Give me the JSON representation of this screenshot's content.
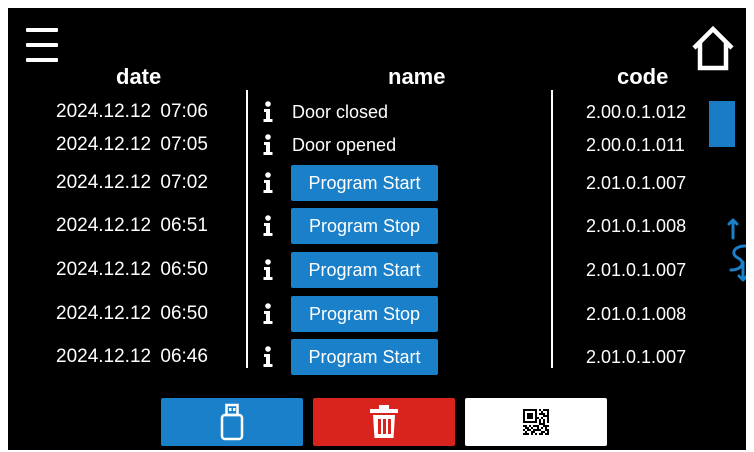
{
  "header": {
    "date": "date",
    "name": "name",
    "code": "code"
  },
  "rows": [
    {
      "date": "2024.12.12 07:06",
      "name": "Door closed",
      "code": "2.00.0.1.012",
      "button": false
    },
    {
      "date": "2024.12.12 07:05",
      "name": "Door opened",
      "code": "2.00.0.1.011",
      "button": false
    },
    {
      "date": "2024.12.12 07:02",
      "name": "Program Start",
      "code": "2.01.0.1.007",
      "button": true
    },
    {
      "date": "2024.12.12 06:51",
      "name": "Program Stop",
      "code": "2.01.0.1.008",
      "button": true
    },
    {
      "date": "2024.12.12 06:50",
      "name": "Program Start",
      "code": "2.01.0.1.007",
      "button": true
    },
    {
      "date": "2024.12.12 06:50",
      "name": "Program Stop",
      "code": "2.01.0.1.008",
      "button": true
    },
    {
      "date": "2024.12.12 06:46",
      "name": "Program Start",
      "code": "2.01.0.1.007",
      "button": true
    }
  ],
  "icons": {
    "menu": "menu-icon",
    "home": "home-icon",
    "info": "info-icon",
    "swap": "scroll-swap-icon",
    "usb": "usb-icon",
    "trash": "trash-icon",
    "qr": "qr-code-icon"
  },
  "colors": {
    "background": "#000000",
    "accent": "#1a80c9",
    "delete": "#d9231d"
  }
}
